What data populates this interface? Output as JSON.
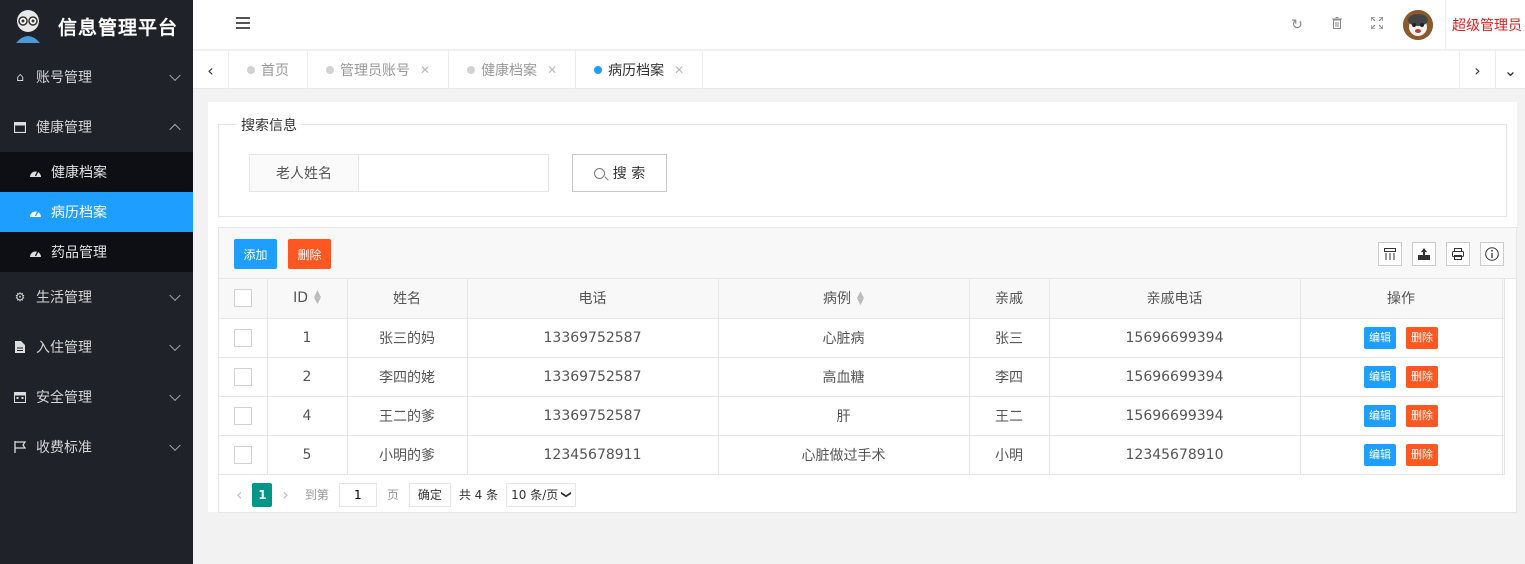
{
  "app": {
    "title": "信息管理平台"
  },
  "sidebar": {
    "groups": [
      {
        "label": "账号管理",
        "icon": "home-icon",
        "expanded": false
      },
      {
        "label": "健康管理",
        "icon": "window-icon",
        "expanded": true,
        "items": [
          {
            "label": "健康档案",
            "icon": "dashboard-icon",
            "active": false
          },
          {
            "label": "病历档案",
            "icon": "dashboard-icon",
            "active": true
          },
          {
            "label": "药品管理",
            "icon": "dashboard-icon",
            "active": false
          }
        ]
      },
      {
        "label": "生活管理",
        "icon": "gears-icon",
        "expanded": false
      },
      {
        "label": "入住管理",
        "icon": "file-icon",
        "expanded": false
      },
      {
        "label": "安全管理",
        "icon": "calendar-icon",
        "expanded": false
      },
      {
        "label": "收费标准",
        "icon": "flag-icon",
        "expanded": false
      }
    ]
  },
  "header": {
    "icons": [
      "refresh-icon",
      "trash-icon",
      "fullscreen-icon"
    ],
    "user": "超级管理员"
  },
  "tabs": [
    {
      "label": "首页",
      "closable": false,
      "active": false
    },
    {
      "label": "管理员账号",
      "closable": true,
      "active": false
    },
    {
      "label": "健康档案",
      "closable": true,
      "active": false
    },
    {
      "label": "病历档案",
      "closable": true,
      "active": true
    }
  ],
  "search": {
    "legend": "搜索信息",
    "label": "老人姓名",
    "value": "",
    "button": "搜 索"
  },
  "toolbar": {
    "add_label": "添加",
    "delete_label": "删除"
  },
  "table": {
    "columns": [
      "ID",
      "姓名",
      "电话",
      "病例",
      "亲戚",
      "亲戚电话",
      "操作"
    ],
    "rows": [
      {
        "id": "1",
        "name": "张三的妈",
        "phone": "13369752587",
        "case": "心脏病",
        "relative": "张三",
        "relative_phone": "15696699394"
      },
      {
        "id": "2",
        "name": "李四的姥",
        "phone": "13369752587",
        "case": "高血糖",
        "relative": "李四",
        "relative_phone": "15696699394"
      },
      {
        "id": "4",
        "name": "王二的爹",
        "phone": "13369752587",
        "case": "肝",
        "relative": "王二",
        "relative_phone": "15696699394"
      },
      {
        "id": "5",
        "name": "小明的爹",
        "phone": "12345678911",
        "case": "心脏做过手术",
        "relative": "小明",
        "relative_phone": "12345678910"
      }
    ],
    "row_actions": {
      "edit": "编辑",
      "delete": "删除"
    }
  },
  "pager": {
    "current": "1",
    "goto_label": "到第",
    "goto_value": "1",
    "page_unit": "页",
    "confirm": "确定",
    "total": "共 4 条",
    "page_size": "10 条/页"
  },
  "colors": {
    "sidebar": "#20222a",
    "active": "#1e9fff",
    "danger": "#ff5722",
    "pager": "#009688",
    "user": "#e02020"
  }
}
